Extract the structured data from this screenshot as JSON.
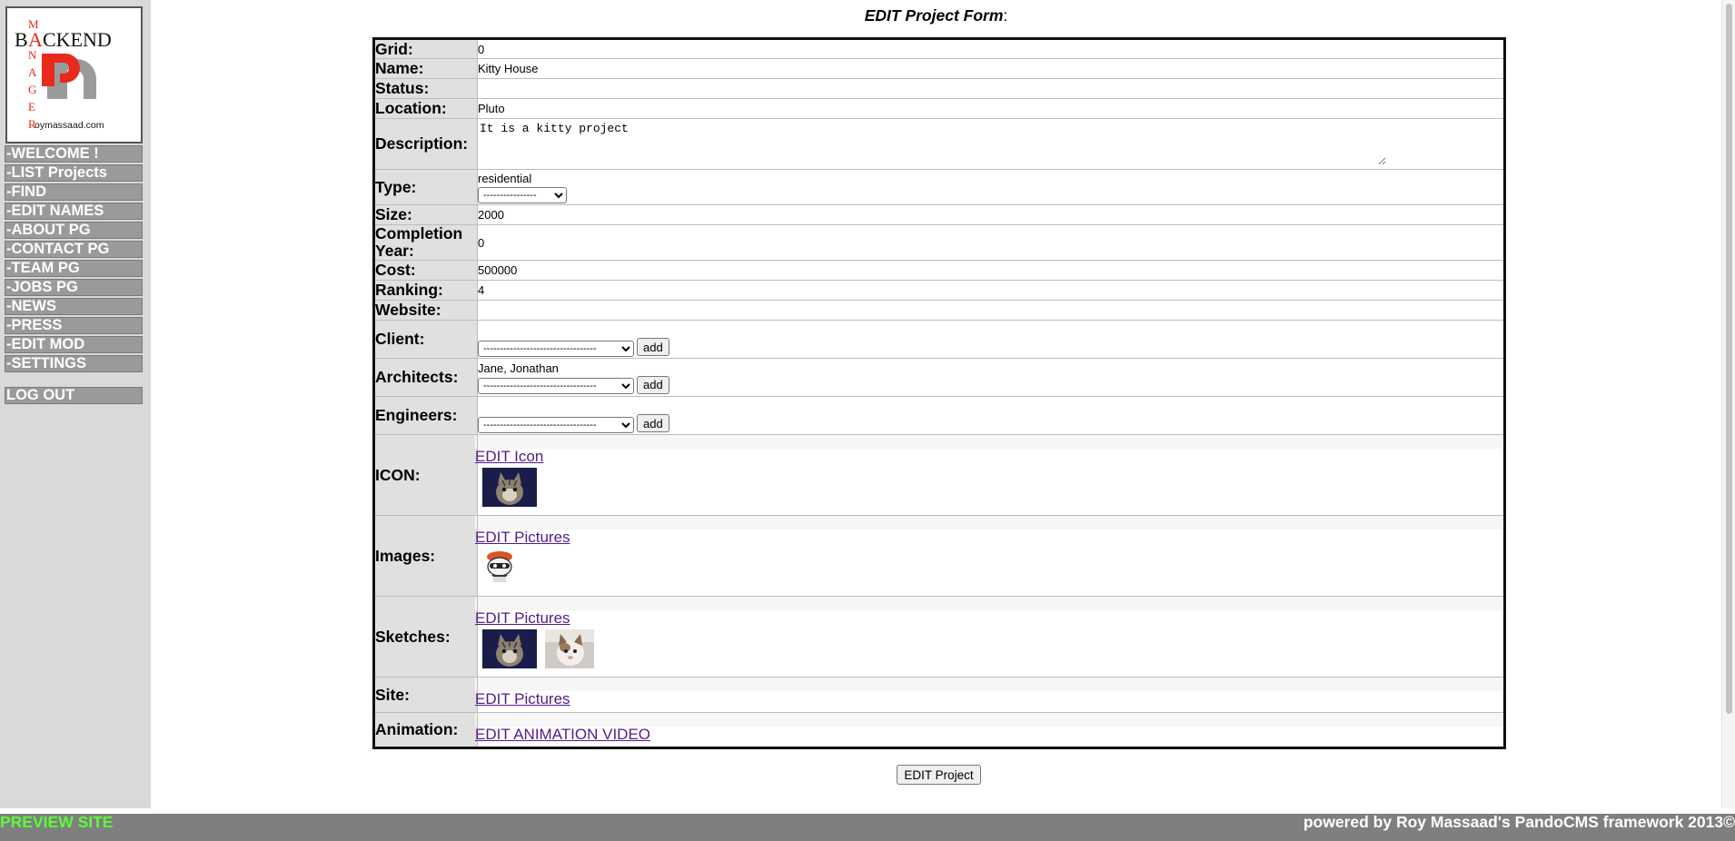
{
  "logo": {
    "letters_vertical": [
      "M",
      "N",
      "G",
      "E",
      "R"
    ],
    "letters_small_a": "A",
    "word": "BACKEND",
    "site": "Roymassaad.com",
    "mark": "R"
  },
  "sidebar": {
    "items": [
      {
        "label": "-WELCOME !"
      },
      {
        "label": "-LIST Projects"
      },
      {
        "label": "-FIND"
      },
      {
        "label": "-EDIT NAMES"
      },
      {
        "label": "-ABOUT PG"
      },
      {
        "label": "-CONTACT PG"
      },
      {
        "label": "-TEAM PG"
      },
      {
        "label": "-JOBS PG"
      },
      {
        "label": "-NEWS"
      },
      {
        "label": "-PRESS"
      },
      {
        "label": "-EDIT MOD"
      },
      {
        "label": "-SETTINGS"
      }
    ],
    "logout_label": "LOG OUT"
  },
  "page": {
    "title_emph": "EDIT Project Form",
    "title_suffix": ":"
  },
  "form": {
    "grid": {
      "label": "Grid:",
      "value": "0"
    },
    "name": {
      "label": "Name:",
      "value": "Kitty House"
    },
    "status": {
      "label": "Status:",
      "value": ""
    },
    "location": {
      "label": "Location:",
      "value": "Pluto"
    },
    "description": {
      "label": "Description:",
      "value": "It is a kitty project"
    },
    "type": {
      "label": "Type:",
      "value": "residential",
      "select_value": "----------------"
    },
    "size": {
      "label": "Size:",
      "value": "2000"
    },
    "completion_year": {
      "label_line1": "Completion",
      "label_line2": "Year:",
      "value": "0"
    },
    "cost": {
      "label": "Cost:",
      "value": "500000"
    },
    "ranking": {
      "label": "Ranking:",
      "value": "4"
    },
    "website": {
      "label": "Website:",
      "value": ""
    },
    "client": {
      "label": "Client:",
      "select_value": "----------------------------------",
      "add_label": "add"
    },
    "architects": {
      "label": "Architects:",
      "current": "Jane, Jonathan",
      "select_value": "----------------------------------",
      "add_label": "add"
    },
    "engineers": {
      "label": "Engineers:",
      "select_value": "----------------------------------",
      "add_label": "add"
    },
    "icon": {
      "label": "ICON:",
      "link": "EDIT Icon",
      "thumbs": [
        "cat-photo"
      ]
    },
    "images": {
      "label": "Images:",
      "link": "EDIT Pictures",
      "thumbs": [
        "cartoon-character"
      ]
    },
    "sketches": {
      "label": "Sketches:",
      "link": "EDIT Pictures",
      "thumbs": [
        "cat-photo",
        "cat-photo-2"
      ]
    },
    "site": {
      "label": "Site:",
      "link": "EDIT Pictures"
    },
    "animation": {
      "label": "Animation:",
      "link": "EDIT ANIMATION VIDEO"
    }
  },
  "submit": {
    "label": "EDIT Project"
  },
  "footer": {
    "preview_label": "PREVIEW SITE",
    "powered_by": "powered by Roy Massaad's PandoCMS framework 2013©"
  },
  "colors": {
    "sidebar_bg": "#d9d9d9",
    "nav_bg": "#9a9a9a",
    "footer_bg": "#7f7f7f",
    "preview_green": "#59ff3a",
    "logo_red": "#e8291c",
    "link_purple": "#551a8b"
  }
}
